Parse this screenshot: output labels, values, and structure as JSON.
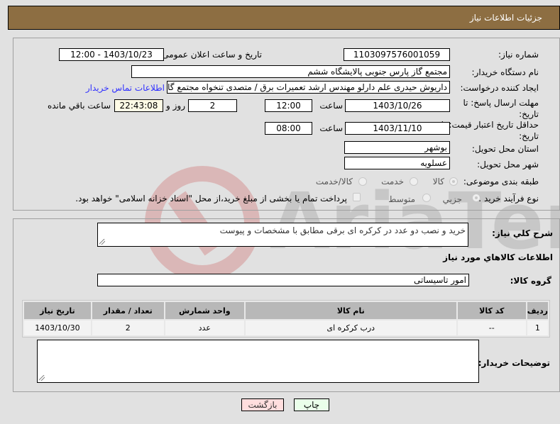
{
  "header": {
    "title": "جزئیات اطلاعات نیاز"
  },
  "fields": {
    "need_number": {
      "label": "شماره نیاز:",
      "value": "1103097576001059"
    },
    "announce_datetime": {
      "label": "تاریخ و ساعت اعلان عمومی:",
      "value": "1403/10/23 - 12:00"
    },
    "buyer_org": {
      "label": "نام دستگاه خریدار:",
      "value": "مجتمع گاز پارس جنوبی  پالایشگاه ششم"
    },
    "requester": {
      "label": "ایجاد کننده درخواست:",
      "value": "داریوش حیدری علم دارلو مهندس ارشد تعمیرات برق / متصدی تنخواه مجتمع گاز",
      "contact_link": "اطلاعات تماس خریدار"
    },
    "reply_deadline": {
      "label": "مهلت ارسال پاسخ: تا تاریخ:",
      "date": "1403/10/26",
      "time_label": "ساعت",
      "time": "12:00",
      "days": "2",
      "days_label": "روز و",
      "remaining": "22:43:08",
      "remaining_label": "ساعت باقي مانده"
    },
    "price_validity": {
      "label": "حداقل تاریخ اعتبار قیمت: تا تاریخ:",
      "date": "1403/11/10",
      "time_label": "ساعت",
      "time": "08:00"
    },
    "province": {
      "label": "استان محل تحویل:",
      "value": "بوشهر"
    },
    "city": {
      "label": "شهر محل تحویل:",
      "value": "عسلویه"
    },
    "category": {
      "label": "طبقه بندی موضوعی:",
      "options": [
        "کالا",
        "خدمت",
        "کالا/خدمت"
      ],
      "selected": "کالا"
    },
    "purchase_type": {
      "label": "نوع فرآیند خرید :",
      "options": [
        "جزیي",
        "متوسط"
      ],
      "selected": "جزیي",
      "treasury_note": "پرداخت تمام یا بخشی از مبلغ خرید،از محل \"اسناد خزانه اسلامی\" خواهد بود."
    }
  },
  "description": {
    "label": "شرح کلي نياز:",
    "value": "خرید و نصب دو عدد در کرکره ای برقی مطابق با مشخصات و پیوست"
  },
  "goods_section": {
    "title": "اطلاعات کالاهاي مورد نياز",
    "group_label": "گروه کالا:",
    "group_value": "امور تاسیساتی"
  },
  "table": {
    "headers": [
      "ردیف",
      "کد کالا",
      "نام کالا",
      "واحد شمارش",
      "تعداد / مقدار",
      "تاریخ نیاز"
    ],
    "rows": [
      [
        "1",
        "--",
        "درب کرکره ای",
        "عدد",
        "2",
        "1403/10/30"
      ]
    ]
  },
  "buyer_notes": {
    "label": "توضیحات خریدار:",
    "value": ""
  },
  "buttons": {
    "print": "چاپ",
    "back": "بازگشت"
  },
  "colors": {
    "header_bg": "#8d6e42",
    "print_bg": "#eaffea",
    "back_bg": "#ffdede",
    "link": "#3030ff"
  }
}
